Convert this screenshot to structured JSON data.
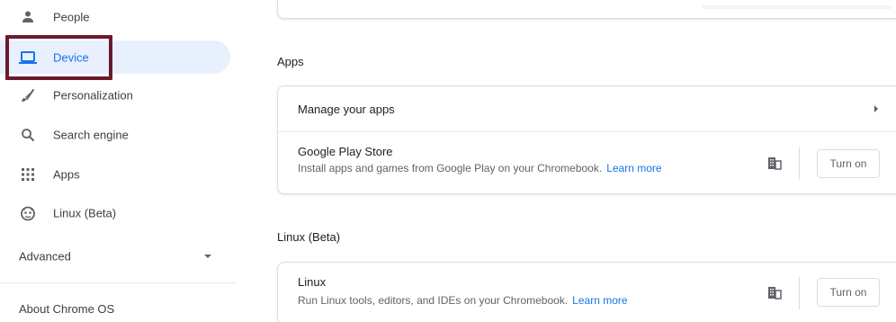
{
  "sidebar": {
    "items": [
      {
        "label": "People",
        "icon": "person-icon"
      },
      {
        "label": "Device",
        "icon": "laptop-icon",
        "selected": true
      },
      {
        "label": "Personalization",
        "icon": "brush-icon"
      },
      {
        "label": "Search engine",
        "icon": "search-icon"
      },
      {
        "label": "Apps",
        "icon": "apps-grid-icon"
      },
      {
        "label": "Linux (Beta)",
        "icon": "linux-icon"
      }
    ],
    "advanced_label": "Advanced",
    "about_label": "About Chrome OS"
  },
  "main": {
    "apps_section": {
      "heading": "Apps",
      "rows": [
        {
          "title": "Manage your apps"
        },
        {
          "title": "Google Play Store",
          "subtitle": "Install apps and games from Google Play on your Chromebook.",
          "learn_more": "Learn more",
          "button": "Turn on"
        }
      ]
    },
    "linux_section": {
      "heading": "Linux (Beta)",
      "rows": [
        {
          "title": "Linux",
          "subtitle": "Run Linux tools, editors, and IDEs on your Chromebook.",
          "learn_more": "Learn more",
          "button": "Turn on"
        }
      ]
    }
  },
  "colors": {
    "accent": "#1a73e8",
    "selected_bg": "#e8f0fe",
    "highlight_border": "#6b1a2e"
  }
}
